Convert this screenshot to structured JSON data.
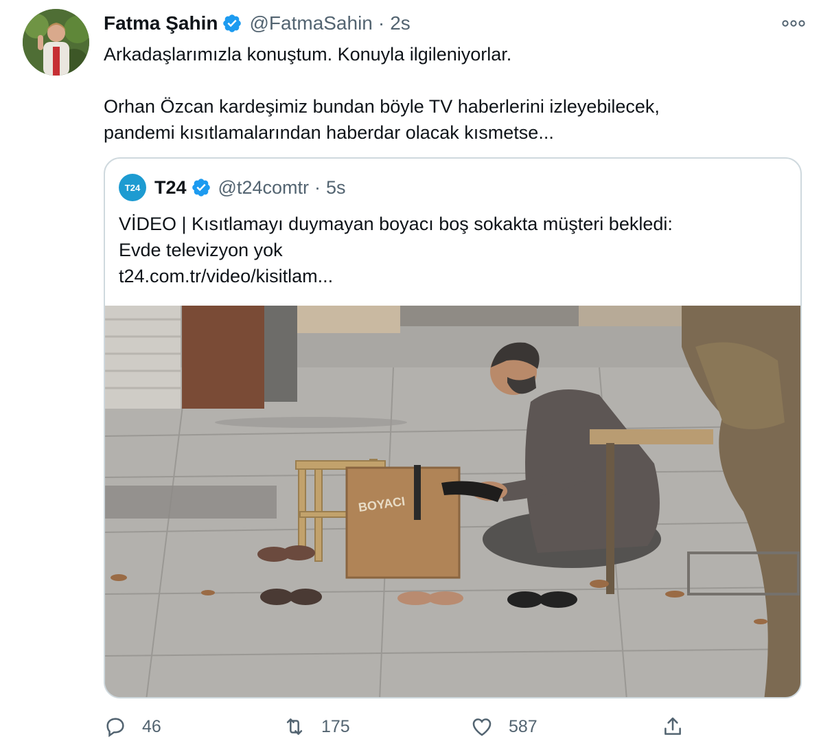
{
  "tweet": {
    "author": {
      "display_name": "Fatma Şahin",
      "handle": "@FatmaSahin",
      "time": "2s",
      "separator": "·",
      "verified": true
    },
    "text": "Arkadaşlarımızla konuştum. Konuyla ilgileniyorlar.\n\nOrhan Özcan kardeşimiz bundan böyle TV haberlerini izleyebilecek,\npandemi kısıtlamalarından haberdar olacak kısmetse...",
    "more_icon": "more-horizontal-icon"
  },
  "quoted_tweet": {
    "avatar_text": "T24",
    "display_name": "T24",
    "handle": "@t24comtr",
    "time": "5s",
    "separator": "·",
    "verified": true,
    "text_lines": [
      "VİDEO | Kısıtlamayı duymayan boyacı boş sokakta müşteri bekledi:",
      "Evde televizyon yok",
      "t24.com.tr/video/kisitlam..."
    ],
    "image_sign_text": "BOYACI"
  },
  "actions": {
    "reply_count": "46",
    "retweet_count": "175",
    "like_count": "587"
  },
  "colors": {
    "verified_blue": "#1d9bf0",
    "secondary_text": "#536471",
    "border": "#cfd9de",
    "t24_brand": "#1d9bd1"
  }
}
